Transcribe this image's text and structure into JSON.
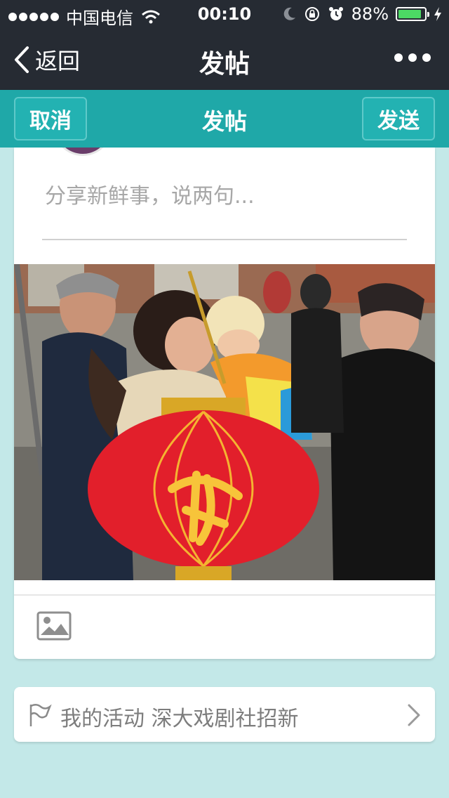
{
  "status_bar": {
    "carrier": "中国电信",
    "time": "00:10",
    "battery": "88%",
    "battery_level": 0.88
  },
  "nav": {
    "back_label": "返回",
    "title": "发帖"
  },
  "toolbar": {
    "cancel_label": "取消",
    "title": "发帖",
    "send_label": "发送"
  },
  "compose": {
    "placeholder": "分享新鲜事，说两句..."
  },
  "activity": {
    "text": "我的活动  深大戏剧社招新"
  },
  "colors": {
    "status_nav_bg": "#262b33",
    "accent_teal": "#1fa8a8",
    "page_bg": "#c3e8e8"
  },
  "icons": [
    "back-chevron-icon",
    "more-icon",
    "image-icon",
    "flag-icon",
    "chevron-right-icon"
  ]
}
